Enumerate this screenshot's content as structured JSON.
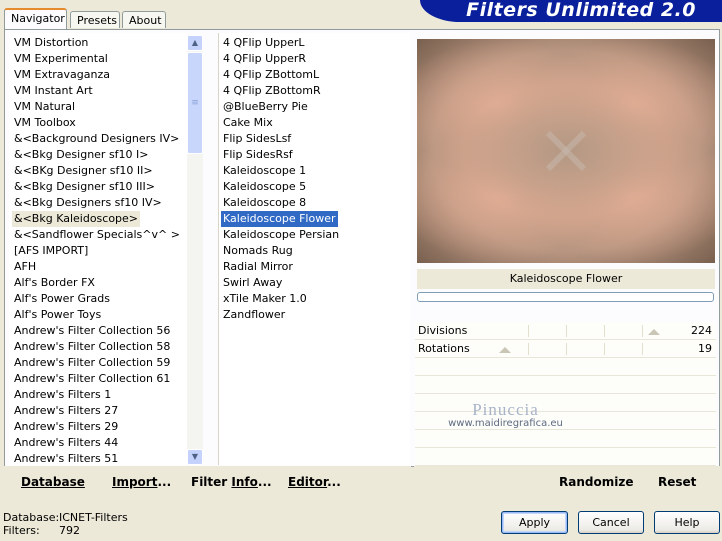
{
  "logo": {
    "title": "Filters Unlimited 2.0"
  },
  "tabs": [
    {
      "label": "Navigator",
      "active": true
    },
    {
      "label": "Presets",
      "active": false
    },
    {
      "label": "About",
      "active": false
    }
  ],
  "categories": [
    "VM Distortion",
    "VM Experimental",
    "VM Extravaganza",
    "VM Instant Art",
    "VM Natural",
    "VM Toolbox",
    "&<Background Designers IV>",
    "&<Bkg Designer sf10 I>",
    "&<BKg Designer sf10 II>",
    "&<Bkg Designer sf10 III>",
    "&<Bkg Designers sf10 IV>",
    "&<Bkg Kaleidoscope>",
    "&<Sandflower Specials^v^ >",
    "[AFS IMPORT]",
    "AFH",
    "Alf's Border FX",
    "Alf's Power Grads",
    "Alf's Power Toys",
    "Andrew's Filter Collection 56",
    "Andrew's Filter Collection 58",
    "Andrew's Filter Collection 59",
    "Andrew's Filter Collection 61",
    "Andrew's Filters 1",
    "Andrew's Filters 27",
    "Andrew's Filters 29",
    "Andrew's Filters 44",
    "Andrew's Filters 51"
  ],
  "categories_focused_index": 11,
  "filters": [
    "4 QFlip UpperL",
    "4 QFlip UpperR",
    "4 QFlip ZBottomL",
    "4 QFlip ZBottomR",
    "@BlueBerry Pie",
    "Cake Mix",
    "Flip SidesLsf",
    "Flip SidesRsf",
    "Kaleidoscope 1",
    "Kaleidoscope 5",
    "Kaleidoscope 8",
    "Kaleidoscope Flower",
    "Kaleidoscope Persian",
    "Nomads Rug",
    "Radial Mirror",
    "Swirl Away",
    "xTile Maker 1.0",
    "Zandflower"
  ],
  "filters_selected_index": 11,
  "preview": {
    "filter_name": "Kaleidoscope Flower"
  },
  "params": [
    {
      "label": "Divisions",
      "value": "224",
      "fraction": 0.88
    },
    {
      "label": "Rotations",
      "value": "19",
      "fraction": 0.075
    }
  ],
  "watermark": {
    "name": "Pinuccia",
    "site": "www.maidiregrafica.eu"
  },
  "bottom_links": {
    "database": "Database",
    "import_u": "Import",
    "import_rest": "...",
    "filter_info_pre": "Filter ",
    "filter_info_u": "Info",
    "filter_info_rest": "...",
    "editor_u": "Editor",
    "editor_rest": "...",
    "randomize": "Randomize",
    "reset": "Reset"
  },
  "status": {
    "database_label": "Database:",
    "database_value": "ICNET-Filters",
    "filters_label": "Filters:",
    "filters_value": "792"
  },
  "buttons": {
    "apply": "Apply",
    "cancel": "Cancel",
    "help": "Help"
  }
}
